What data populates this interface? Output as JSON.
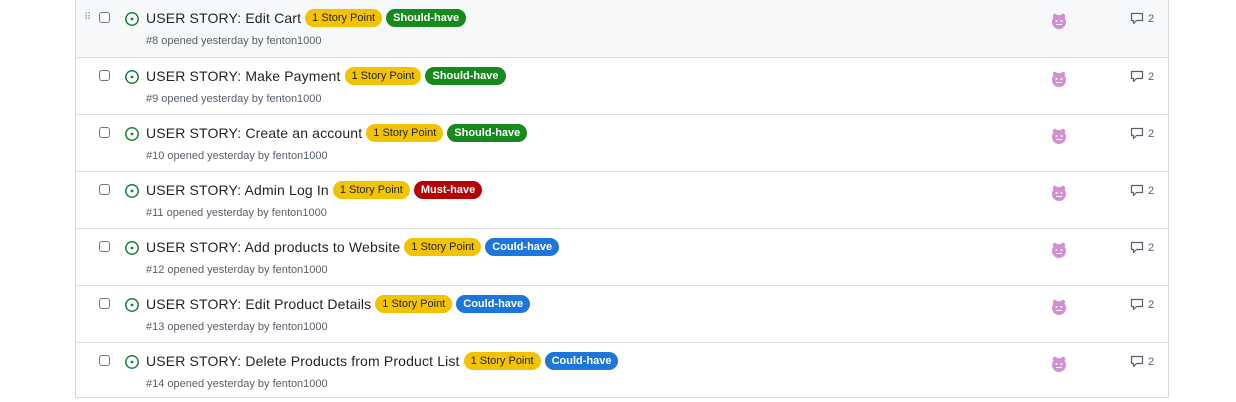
{
  "colors": {
    "open_icon": "#1a7f37",
    "avatar": "#d28fd1",
    "story_point": "#f2c300",
    "should_have": "#168a1c",
    "must_have": "#b60205",
    "could_have": "#1d76db"
  },
  "issues": [
    {
      "title": "USER STORY: Edit Cart",
      "labels": [
        {
          "text": "1 Story Point",
          "color": "yellow"
        },
        {
          "text": "Should-have",
          "color": "green"
        }
      ],
      "meta": "#8 opened yesterday by fenton1000",
      "comments": "2"
    },
    {
      "title": "USER STORY: Make Payment",
      "labels": [
        {
          "text": "1 Story Point",
          "color": "yellow"
        },
        {
          "text": "Should-have",
          "color": "green"
        }
      ],
      "meta": "#9 opened yesterday by fenton1000",
      "comments": "2"
    },
    {
      "title": "USER STORY: Create an account",
      "labels": [
        {
          "text": "1 Story Point",
          "color": "yellow"
        },
        {
          "text": "Should-have",
          "color": "green"
        }
      ],
      "meta": "#10 opened yesterday by fenton1000",
      "comments": "2"
    },
    {
      "title": "USER STORY: Admin Log In",
      "labels": [
        {
          "text": "1 Story Point",
          "color": "yellow"
        },
        {
          "text": "Must-have",
          "color": "red"
        }
      ],
      "meta": "#11 opened yesterday by fenton1000",
      "comments": "2"
    },
    {
      "title": "USER STORY: Add products to Website",
      "labels": [
        {
          "text": "1 Story Point",
          "color": "yellow"
        },
        {
          "text": "Could-have",
          "color": "blue"
        }
      ],
      "meta": "#12 opened yesterday by fenton1000",
      "comments": "2"
    },
    {
      "title": "USER STORY: Edit Product Details",
      "labels": [
        {
          "text": "1 Story Point",
          "color": "yellow"
        },
        {
          "text": "Could-have",
          "color": "blue"
        }
      ],
      "meta": "#13 opened yesterday by fenton1000",
      "comments": "2"
    },
    {
      "title": "USER STORY: Delete Products from Product List",
      "labels": [
        {
          "text": "1 Story Point",
          "color": "yellow"
        },
        {
          "text": "Could-have",
          "color": "blue"
        }
      ],
      "meta": "#14 opened yesterday by fenton1000",
      "comments": "2"
    }
  ]
}
